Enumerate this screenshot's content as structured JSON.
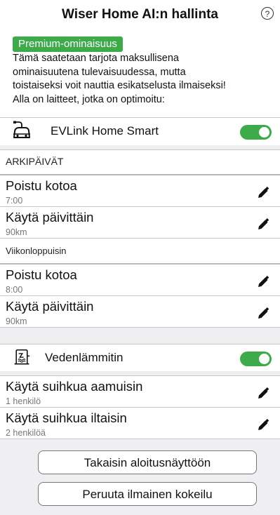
{
  "header": {
    "title": "Wiser Home AI:n hallinta",
    "help_label": "?"
  },
  "premium": {
    "badge": "Premium-ominaisuus",
    "line1": "Tämä saatetaan tarjota maksullisena",
    "line2": "ominaisuutena tulevaisuudessa, mutta",
    "line3": "toistaiseksi voit nauttia esikatselusta ilmaiseksi!",
    "line4": "Alla on laitteet, jotka on optimoitu:"
  },
  "ev": {
    "device_name": "EVLink Home Smart",
    "enabled": true,
    "icon": "ev-charger-icon",
    "weekdays_label": "ARKIPÄIVÄT",
    "weekend_label": "Viikonloppuisin",
    "weekday_items": [
      {
        "title": "Poistu kotoa",
        "value": "7:00"
      },
      {
        "title": "Käytä päivittäin",
        "value": "90km"
      }
    ],
    "weekend_items": [
      {
        "title": "Poistu kotoa",
        "value": "8:00"
      },
      {
        "title": "Käytä päivittäin",
        "value": "90km"
      }
    ]
  },
  "heater": {
    "device_name": "Vedenlämmitin",
    "enabled": true,
    "icon": "water-heater-icon",
    "items": [
      {
        "title": "Käytä suihkua aamuisin",
        "value": "1 henkilö"
      },
      {
        "title": "Käytä suihkua iltaisin",
        "value": "2 henkilöä"
      }
    ]
  },
  "buttons": {
    "back": "Takaisin aloitusnäyttöön",
    "cancel": "Peruuta ilmainen kokeilu"
  },
  "colors": {
    "accent": "#3dab4a",
    "section_bg": "#efeff1"
  }
}
